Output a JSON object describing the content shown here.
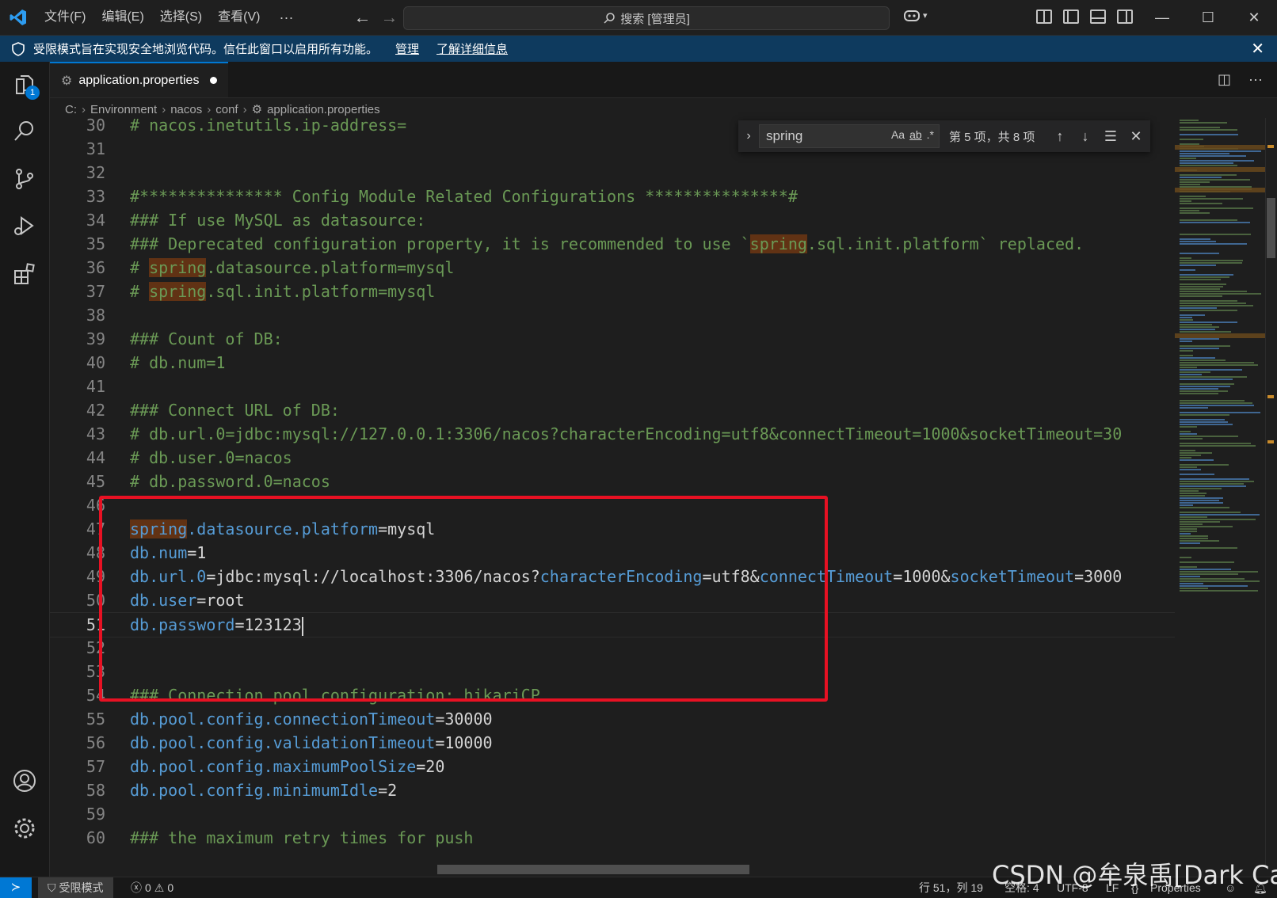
{
  "menu": {
    "file": "文件(F)",
    "edit": "编辑(E)",
    "select": "选择(S)",
    "view": "查看(V)",
    "more": "···"
  },
  "search": {
    "label": "搜索 [管理员]"
  },
  "banner": {
    "message": "受限模式旨在实现安全地浏览代码。信任此窗口以启用所有功能。",
    "manage_link": "管理",
    "learn_more_link": "了解详细信息"
  },
  "explorer_badge": "1",
  "tab": {
    "label": "application.properties"
  },
  "breadcrumb": [
    "C:",
    "Environment",
    "nacos",
    "conf",
    "application.properties"
  ],
  "find": {
    "query": "spring",
    "case_opt": "Aa",
    "word_opt": "ab",
    "regex_opt": ".*",
    "count": "第 5 项，共 8 项"
  },
  "editor_lines": [
    {
      "num": "30",
      "segments": [
        {
          "t": "# nacos.inetutils.ip-address=",
          "c": "c-com"
        }
      ]
    },
    {
      "num": "31",
      "segments": []
    },
    {
      "num": "32",
      "segments": []
    },
    {
      "num": "33",
      "segments": [
        {
          "t": "#*************** Config Module Related Configurations ***************#",
          "c": "c-com"
        }
      ]
    },
    {
      "num": "34",
      "segments": [
        {
          "t": "### If use MySQL as datasource:",
          "c": "c-com"
        }
      ]
    },
    {
      "num": "35",
      "segments": [
        {
          "t": "### Deprecated configuration property, it is recommended to use `",
          "c": "c-com"
        },
        {
          "t": "spring",
          "c": "c-com hl"
        },
        {
          "t": ".sql.init.platform` replaced.",
          "c": "c-com"
        }
      ]
    },
    {
      "num": "36",
      "segments": [
        {
          "t": "# ",
          "c": "c-com"
        },
        {
          "t": "spring",
          "c": "c-com hl"
        },
        {
          "t": ".datasource.platform=mysql",
          "c": "c-com"
        }
      ]
    },
    {
      "num": "37",
      "segments": [
        {
          "t": "# ",
          "c": "c-com"
        },
        {
          "t": "spring",
          "c": "c-com hl"
        },
        {
          "t": ".sql.init.platform=mysql",
          "c": "c-com"
        }
      ]
    },
    {
      "num": "38",
      "segments": []
    },
    {
      "num": "39",
      "segments": [
        {
          "t": "### Count of DB:",
          "c": "c-com"
        }
      ]
    },
    {
      "num": "40",
      "segments": [
        {
          "t": "# db.num=1",
          "c": "c-com"
        }
      ]
    },
    {
      "num": "41",
      "segments": []
    },
    {
      "num": "42",
      "segments": [
        {
          "t": "### Connect URL of DB:",
          "c": "c-com"
        }
      ]
    },
    {
      "num": "43",
      "segments": [
        {
          "t": "# db.url.0=jdbc:mysql://127.0.0.1:3306/nacos?characterEncoding=utf8&connectTimeout=1000&socketTimeout=30",
          "c": "c-com"
        }
      ]
    },
    {
      "num": "44",
      "segments": [
        {
          "t": "# db.user.0=nacos",
          "c": "c-com"
        }
      ]
    },
    {
      "num": "45",
      "segments": [
        {
          "t": "# db.password.0=nacos",
          "c": "c-com"
        }
      ]
    },
    {
      "num": "46",
      "segments": []
    },
    {
      "num": "47",
      "segments": [
        {
          "t": "spring",
          "c": "c-key hl"
        },
        {
          "t": ".datasource.platform",
          "c": "c-key"
        },
        {
          "t": "=mysql",
          "c": "c-val"
        }
      ]
    },
    {
      "num": "48",
      "segments": [
        {
          "t": "db.num",
          "c": "c-key"
        },
        {
          "t": "=1",
          "c": "c-val"
        }
      ]
    },
    {
      "num": "49",
      "segments": [
        {
          "t": "db.url.0",
          "c": "c-key"
        },
        {
          "t": "=jdbc:mysql://localhost:3306/nacos?",
          "c": "c-val"
        },
        {
          "t": "characterEncoding",
          "c": "c-key"
        },
        {
          "t": "=utf8&",
          "c": "c-val"
        },
        {
          "t": "connectTimeout",
          "c": "c-key"
        },
        {
          "t": "=1000&",
          "c": "c-val"
        },
        {
          "t": "socketTimeout",
          "c": "c-key"
        },
        {
          "t": "=3000",
          "c": "c-val"
        }
      ]
    },
    {
      "num": "50",
      "segments": [
        {
          "t": "db.user",
          "c": "c-key"
        },
        {
          "t": "=root",
          "c": "c-val"
        }
      ]
    },
    {
      "num": "51",
      "current": true,
      "segments": [
        {
          "t": "db.password",
          "c": "c-key"
        },
        {
          "t": "=123123",
          "c": "c-val"
        }
      ]
    },
    {
      "num": "52",
      "segments": []
    },
    {
      "num": "53",
      "segments": []
    },
    {
      "num": "54",
      "segments": [
        {
          "t": "### Connection pool configuration: hikariCP",
          "c": "c-com"
        }
      ]
    },
    {
      "num": "55",
      "segments": [
        {
          "t": "db.pool.config.connectionTimeout",
          "c": "c-key"
        },
        {
          "t": "=30000",
          "c": "c-val"
        }
      ]
    },
    {
      "num": "56",
      "segments": [
        {
          "t": "db.pool.config.validationTimeout",
          "c": "c-key"
        },
        {
          "t": "=10000",
          "c": "c-val"
        }
      ]
    },
    {
      "num": "57",
      "segments": [
        {
          "t": "db.pool.config.maximumPoolSize",
          "c": "c-key"
        },
        {
          "t": "=20",
          "c": "c-val"
        }
      ]
    },
    {
      "num": "58",
      "segments": [
        {
          "t": "db.pool.config.minimumIdle",
          "c": "c-key"
        },
        {
          "t": "=2",
          "c": "c-val"
        }
      ]
    },
    {
      "num": "59",
      "segments": []
    },
    {
      "num": "60",
      "segments": [
        {
          "t": "### the maximum retry times for push",
          "c": "c-com"
        }
      ]
    }
  ],
  "status": {
    "restricted": "受限模式",
    "errors": "0",
    "warnings": "0",
    "position": "行 51，列 19",
    "spaces": "空格: 4",
    "encoding": "UTF-8",
    "eol": "LF",
    "language": "Properties"
  },
  "watermark": "CSDN @牟泉禹[Dark Cat]",
  "colors": {
    "accent": "#0078d4",
    "banner": "#0e3a5e",
    "find_highlight": "#613214",
    "red_box": "#e81123"
  }
}
